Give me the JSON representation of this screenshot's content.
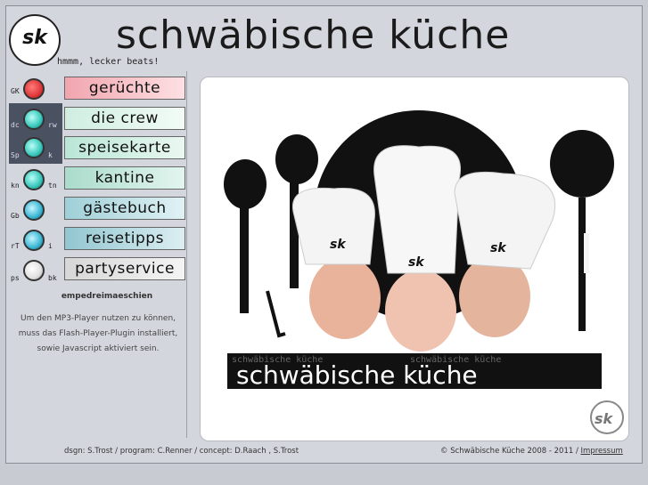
{
  "header": {
    "logo_text": "sk",
    "title": "schwäbische küche",
    "tagline": "hmmm, lecker beats!"
  },
  "knobs": [
    {
      "top_label": "GK",
      "right_label": "",
      "color": "#e0383a"
    },
    {
      "top_label": "dc",
      "right_label": "rw",
      "color": "#38c6bb"
    },
    {
      "top_label": "Sp",
      "right_label": "k",
      "color": "#38c6bb"
    },
    {
      "top_label": "kn",
      "right_label": "tn",
      "color": "#38c6bb"
    },
    {
      "top_label": "Gb",
      "right_label": "",
      "color": "#3ab6d4"
    },
    {
      "top_label": "rT",
      "right_label": "i",
      "color": "#3ab6d4"
    },
    {
      "top_label": "ps",
      "right_label": "bk",
      "color": "#f0f0f0"
    }
  ],
  "nav": [
    {
      "label": "gerüchte",
      "color": "#f1a5ae"
    },
    {
      "label": "die crew",
      "color": "#cfeee0"
    },
    {
      "label": "speisekarte",
      "color": "#b9e6d6"
    },
    {
      "label": "kantine",
      "color": "#aadccb"
    },
    {
      "label": "gästebuch",
      "color": "#9fcfd7"
    },
    {
      "label": "reisetipps",
      "color": "#92c6d0"
    },
    {
      "label": "partyservice",
      "color": "#d7d7d7"
    }
  ],
  "player": {
    "title": "empedreimaeschien",
    "note": "Um den MP3-Player nutzen zu können, muss das Flash-Player-Plugin installiert, sowie Javascript aktiviert sein."
  },
  "banner": {
    "title": "schwäbische küche",
    "repeat_text": "schwäbische küche",
    "hat_text": "sk",
    "corner_logo": "sk"
  },
  "footer": {
    "credits": "dsgn: S.Trost / program: C.Renner / concept: D.Raach , S.Trost",
    "copyright": "© Schwäbische Küche 2008 - 2011 /",
    "impressum": "Impressum"
  }
}
